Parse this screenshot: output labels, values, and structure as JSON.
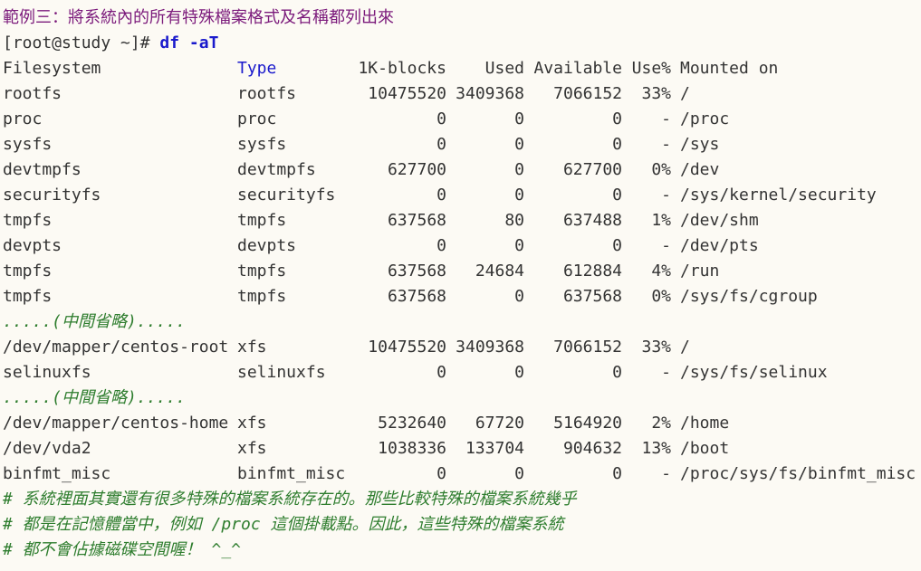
{
  "heading": "範例三：將系統內的所有特殊檔案格式及名稱都列出來",
  "prompt": "[root@study ~]# ",
  "command": "df -aT",
  "header": {
    "filesystem": "Filesystem",
    "type": "Type",
    "blocks": "1K-blocks",
    "used": "Used",
    "available": "Available",
    "use_pct": "Use%",
    "mounted": "Mounted on"
  },
  "rows": [
    {
      "fs": "rootfs",
      "type": "rootfs",
      "blocks": "10475520",
      "used": "3409368",
      "avail": "7066152",
      "pct": "33%",
      "mnt": "/"
    },
    {
      "fs": "proc",
      "type": "proc",
      "blocks": "0",
      "used": "0",
      "avail": "0",
      "pct": "-",
      "mnt": "/proc"
    },
    {
      "fs": "sysfs",
      "type": "sysfs",
      "blocks": "0",
      "used": "0",
      "avail": "0",
      "pct": "-",
      "mnt": "/sys"
    },
    {
      "fs": "devtmpfs",
      "type": "devtmpfs",
      "blocks": "627700",
      "used": "0",
      "avail": "627700",
      "pct": "0%",
      "mnt": "/dev"
    },
    {
      "fs": "securityfs",
      "type": "securityfs",
      "blocks": "0",
      "used": "0",
      "avail": "0",
      "pct": "-",
      "mnt": "/sys/kernel/security"
    },
    {
      "fs": "tmpfs",
      "type": "tmpfs",
      "blocks": "637568",
      "used": "80",
      "avail": "637488",
      "pct": "1%",
      "mnt": "/dev/shm"
    },
    {
      "fs": "devpts",
      "type": "devpts",
      "blocks": "0",
      "used": "0",
      "avail": "0",
      "pct": "-",
      "mnt": "/dev/pts"
    },
    {
      "fs": "tmpfs",
      "type": "tmpfs",
      "blocks": "637568",
      "used": "24684",
      "avail": "612884",
      "pct": "4%",
      "mnt": "/run"
    },
    {
      "fs": "tmpfs",
      "type": "tmpfs",
      "blocks": "637568",
      "used": "0",
      "avail": "637568",
      "pct": "0%",
      "mnt": "/sys/fs/cgroup"
    },
    {
      "fs": "/dev/mapper/centos-root",
      "type": "xfs",
      "blocks": "10475520",
      "used": "3409368",
      "avail": "7066152",
      "pct": "33%",
      "mnt": "/"
    },
    {
      "fs": "selinuxfs",
      "type": "selinuxfs",
      "blocks": "0",
      "used": "0",
      "avail": "0",
      "pct": "-",
      "mnt": "/sys/fs/selinux"
    },
    {
      "fs": "/dev/mapper/centos-home",
      "type": "xfs",
      "blocks": "5232640",
      "used": "67720",
      "avail": "5164920",
      "pct": "2%",
      "mnt": "/home"
    },
    {
      "fs": "/dev/vda2",
      "type": "xfs",
      "blocks": "1038336",
      "used": "133704",
      "avail": "904632",
      "pct": "13%",
      "mnt": "/boot"
    },
    {
      "fs": "binfmt_misc",
      "type": "binfmt_misc",
      "blocks": "0",
      "used": "0",
      "avail": "0",
      "pct": "-",
      "mnt": "/proc/sys/fs/binfmt_misc"
    }
  ],
  "omitted": ".....(中間省略).....",
  "comments": [
    "# 系統裡面其實還有很多特殊的檔案系統存在的。那些比較特殊的檔案系統幾乎",
    "# 都是在記憶體當中，例如 /proc 這個掛載點。因此，這些特殊的檔案系統",
    "# 都不會佔據磁碟空間喔！ ^_^"
  ],
  "colors": {
    "heading": "#7b1a7b",
    "command": "#1a1acc",
    "comment": "#2e7d2e",
    "background": "#fcfaf4"
  }
}
